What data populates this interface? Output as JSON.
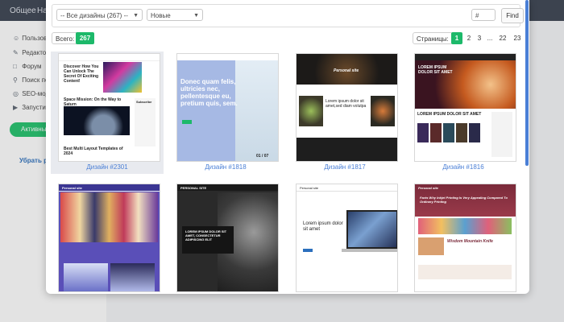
{
  "background": {
    "topnav": [
      "Общее",
      "На"
    ],
    "sidebar": [
      {
        "icon": "user-icon",
        "label": "Пользова"
      },
      {
        "icon": "edit-icon",
        "label": "Редактор"
      },
      {
        "icon": "chat-icon",
        "label": "Форум"
      },
      {
        "icon": "search-icon",
        "label": "Поиск по"
      },
      {
        "icon": "seo-icon",
        "label": "SEO-мод"
      },
      {
        "icon": "launch-icon",
        "label": "Запусти"
      }
    ],
    "active_button": "Активны",
    "link": "Убрать ре"
  },
  "filters": {
    "category": "-- Все дизайны (267) --",
    "sort": "Новые",
    "number_placeholder": "#",
    "find": "Find"
  },
  "total": {
    "label": "Всего:",
    "count": "267"
  },
  "pagination": {
    "label": "Страницы:",
    "pages": [
      "1",
      "2",
      "3",
      "...",
      "22",
      "23"
    ],
    "current": "1"
  },
  "designs": [
    {
      "caption": "Дизайн #2301",
      "texts": [
        "Discover How You Can Unlock The Secret Of Exciting Content!",
        "Space Mission: On the Way to Saturn",
        "Best Multi Layout Templates of 2024",
        "Subscribe"
      ]
    },
    {
      "caption": "Дизайн #1818",
      "texts": [
        "Donec quam felis, ultricies nec, pellentesque eu, pretium quis, sem.",
        "01 / 07"
      ]
    },
    {
      "caption": "Дизайн #1817",
      "texts": [
        "Personal site",
        "Lorem ipsum dolor sit amet,sed diam volutpa"
      ]
    },
    {
      "caption": "Дизайн #1816",
      "texts": [
        "LOREM IPSUM DOLOR SIT AMET",
        "LOREM IPSUM DOLOR SIT AMET"
      ]
    },
    {
      "caption": "",
      "texts": [
        "Personal site"
      ]
    },
    {
      "caption": "",
      "texts": [
        "PERSONAL SITE",
        "LOREM IPSUM DOLOR SIT AMET, CONSECTETUR ADIPISCING ELIT"
      ]
    },
    {
      "caption": "",
      "texts": [
        "Personal site",
        "Lorem ipsum dolor sit amet"
      ]
    },
    {
      "caption": "",
      "texts": [
        "Personal site",
        "Facts Why Inkjet Printing Is Very Appealing Compared To Ordinary Printing",
        "Wisdom Mountain Knife"
      ]
    }
  ],
  "colors": {
    "accent": "#1db96a",
    "link": "#4a7fd6",
    "scrollbar": "#4a7fd6"
  }
}
